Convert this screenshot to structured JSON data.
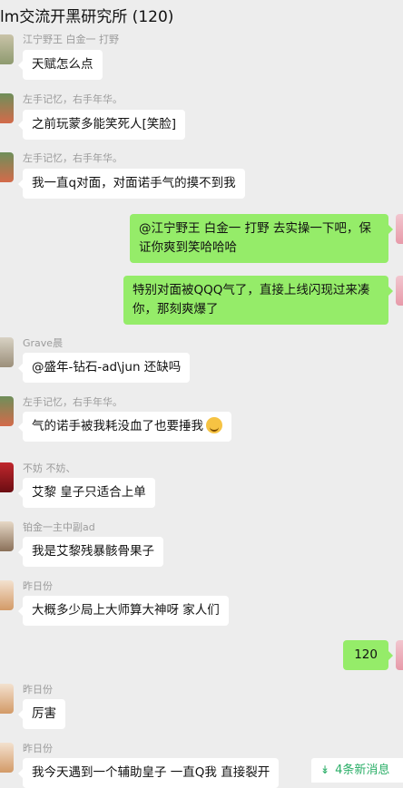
{
  "header": {
    "title": "lm交流开黑研究所 (120)"
  },
  "messages": [
    {
      "sender": "江宁野王 白金一 打野",
      "text": "天赋怎么点"
    },
    {
      "sender": "左手记忆，右手年华。",
      "text": "之前玩蒙多能笑死人[笑脸]"
    },
    {
      "sender": "左手记忆，右手年华。",
      "text": "我一直q对面，对面诺手气的摸不到我"
    },
    {
      "text": "@江宁野王 白金一 打野 去实操一下吧，保证你爽到笑哈哈哈"
    },
    {
      "text": "特别对面被QQQ气了，直接上线闪现过来凑你，那刻爽爆了"
    },
    {
      "sender": "Grave晨",
      "text": "@盛年-钻石-ad\\jun 还缺吗"
    },
    {
      "sender": "左手记忆，右手年华。",
      "text": "气的诺手被我耗没血了也要捶我",
      "emoji": "grin-sweat-emoji"
    },
    {
      "sender": "不妨 不妨、",
      "text": "艾黎 皇子只适合上单"
    },
    {
      "sender": "铂金一主中副ad",
      "text": "我是艾黎残暴骸骨果子"
    },
    {
      "sender": "昨日份",
      "text": "大概多少局上大师算大神呀 家人们"
    },
    {
      "text": "120"
    },
    {
      "sender": "昨日份",
      "text": "厉害"
    },
    {
      "sender": "昨日份",
      "text": "我今天遇到一个辅助皇子 一直Q我  直接裂开"
    }
  ],
  "new_messages": {
    "label": "4条新消息",
    "icon": "double-chevron-down-icon"
  },
  "colors": {
    "background": "#ededed",
    "outgoing_bubble": "#95ec69",
    "incoming_bubble": "#ffffff",
    "accent": "#2aae67"
  }
}
